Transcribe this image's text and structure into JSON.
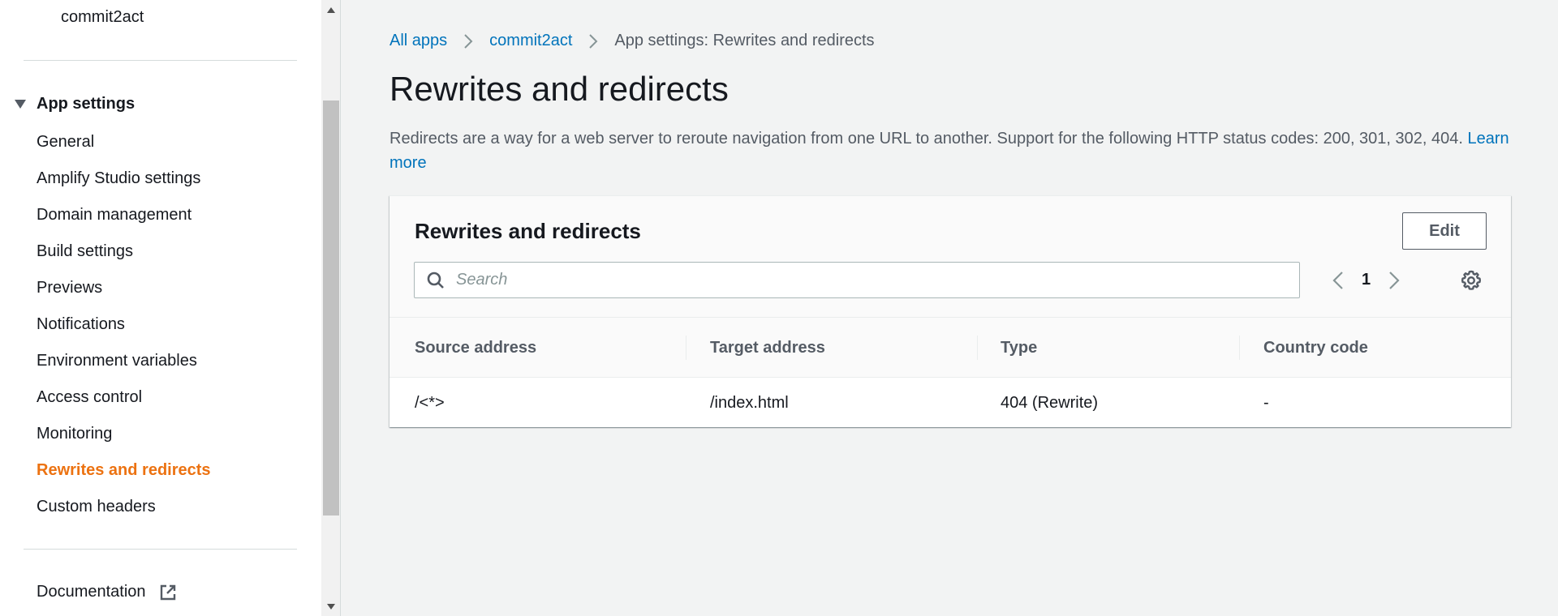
{
  "sidebar": {
    "app_name": "commit2act",
    "section_label": "App settings",
    "items": [
      {
        "label": "General"
      },
      {
        "label": "Amplify Studio settings"
      },
      {
        "label": "Domain management"
      },
      {
        "label": "Build settings"
      },
      {
        "label": "Previews"
      },
      {
        "label": "Notifications"
      },
      {
        "label": "Environment variables"
      },
      {
        "label": "Access control"
      },
      {
        "label": "Monitoring"
      },
      {
        "label": "Rewrites and redirects"
      },
      {
        "label": "Custom headers"
      }
    ],
    "active_item": "Rewrites and redirects",
    "documentation_label": "Documentation",
    "documentation_icon": "external-link-icon"
  },
  "breadcrumb": {
    "items": [
      "All apps",
      "commit2act",
      "App settings: Rewrites and redirects"
    ],
    "separator_icon": "chevron-right-icon"
  },
  "page": {
    "title": "Rewrites and redirects",
    "description": "Redirects are a way for a web server to reroute navigation from one URL to another. Support for the following HTTP status codes: 200, 301, 302, 404.",
    "learn_more": "Learn more"
  },
  "card": {
    "title": "Rewrites and redirects",
    "edit_label": "Edit",
    "search": {
      "placeholder": "Search",
      "value": ""
    },
    "pagination": {
      "current_page": "1"
    },
    "settings_icon": "gear-icon",
    "columns": [
      "Source address",
      "Target address",
      "Type",
      "Country code"
    ],
    "rows": [
      {
        "source": "/<*>",
        "target": "/index.html",
        "type": "404 (Rewrite)",
        "country": "-"
      }
    ]
  },
  "colors": {
    "link": "#0073bb",
    "active_nav": "#ec7211",
    "background": "#f2f3f3"
  }
}
